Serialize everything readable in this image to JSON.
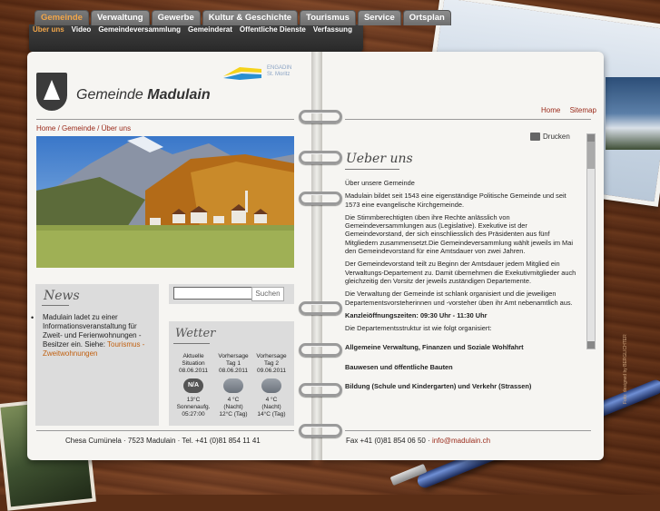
{
  "nav": {
    "top": [
      "Gemeinde",
      "Verwaltung",
      "Gewerbe",
      "Kultur & Geschichte",
      "Tourismus",
      "Service",
      "Ortsplan"
    ],
    "sub": [
      "Über uns",
      "Video",
      "Gemeindeversammlung",
      "Gemeinderat",
      "Öffentliche Dienste",
      "Verfassung"
    ]
  },
  "brand": {
    "prefix": "Gemeinde ",
    "name": "Madulain",
    "logo_text_1": "ENGADIN",
    "logo_text_2": "St. Moritz"
  },
  "breadcrumb": {
    "home": "Home",
    "sep1": " / ",
    "gemeinde": "Gemeinde",
    "sep2": " / ",
    "current": "Über uns"
  },
  "top_links": {
    "home": "Home",
    "sitemap": "Sitemap"
  },
  "print": {
    "label": "Drucken",
    "icon": "printer-icon"
  },
  "news": {
    "title": "News",
    "text": "Madulain ladet zu einer Informationsveranstaltung für Zweit- und Ferienwohnungen - Besitzer ein. Siehe: ",
    "link": "Tourismus - Zweitwohnungen"
  },
  "search": {
    "placeholder": "",
    "button": "Suchen"
  },
  "weather": {
    "title": "Wetter",
    "columns": [
      {
        "head1": "Aktuelle",
        "head2": "Situation",
        "date": "08.06.2011",
        "icon": "na-icon",
        "icon_text": "N/A",
        "line1": "13°C",
        "line2": "Sonnenaufg.",
        "line3": "05:27:00"
      },
      {
        "head1": "Vorhersage",
        "head2": "Tag 1",
        "date": "08.06.2011",
        "icon": "cloud-rain-icon",
        "icon_text": "",
        "line1": "4 °C",
        "line2": "(Nacht)",
        "line3": "12°C (Tag)"
      },
      {
        "head1": "Vorhersage",
        "head2": "Tag 2",
        "date": "09.06.2011",
        "icon": "cloud-rain-icon",
        "icon_text": "",
        "line1": "4 °C",
        "line2": "(Nacht)",
        "line3": "14°C (Tag)"
      }
    ]
  },
  "footer": {
    "left": "Chesa Cumünela · 7523 Madulain · Tel. +41 (0)81 854 11 41",
    "right_prefix": "Fax +41 (0)81 854 06 50 · ",
    "email": "info@madulain.ch"
  },
  "content": {
    "title": "Ueber uns",
    "intro": "Über unsere Gemeinde",
    "paragraphs": [
      "Madulain bildet seit 1543 eine eigenständige Politische Gemeinde und seit 1573 eine evangelische Kirchgemeinde.",
      "Die Stimmberechtigten üben ihre Rechte anlässlich von Gemeindeversammlungen aus (Legislative). Exekutive ist der Gemeindevorstand, der sich einschliesslich des Präsidenten aus fünf Mitgliedern zusammensetzt.Die Gemeindeversammlung wählt jeweils im Mai den Gemeindevorstand für eine Amtsdauer von zwei Jahren.",
      "Der Gemeindevorstand teilt zu Beginn der Amtsdauer jedem Mitglied ein Verwaltungs-Departement zu. Damit übernehmen die Exekutivmitglieder auch gleichzeitig den Vorsitz der jeweils zuständigen Departemente.",
      "Die Verwaltung der Gemeinde ist schlank organisiert und die jeweiligen Departementsvorsteherinnen und -vorsteher üben ihr Amt nebenamtlich aus."
    ],
    "office_hours": "Kanzleiöffnungszeiten: 09:30 Uhr - 11:30 Uhr",
    "structure_intro": "Die Departementsstruktur ist wie folgt organisiert:",
    "departments": [
      "Allgemeine Verwaltung, Finanzen und Soziale Wohlfahrt",
      "Bauwesen und öffentliche Bauten",
      "Bildung (Schule und Kindergarten) und Verkehr (Strassen)"
    ]
  },
  "side_text": "Foto: designed by BERGLICHTER",
  "colors": {
    "accent_orange": "#f2a64a",
    "link_red": "#9a2a1a",
    "news_link": "#c06010"
  }
}
